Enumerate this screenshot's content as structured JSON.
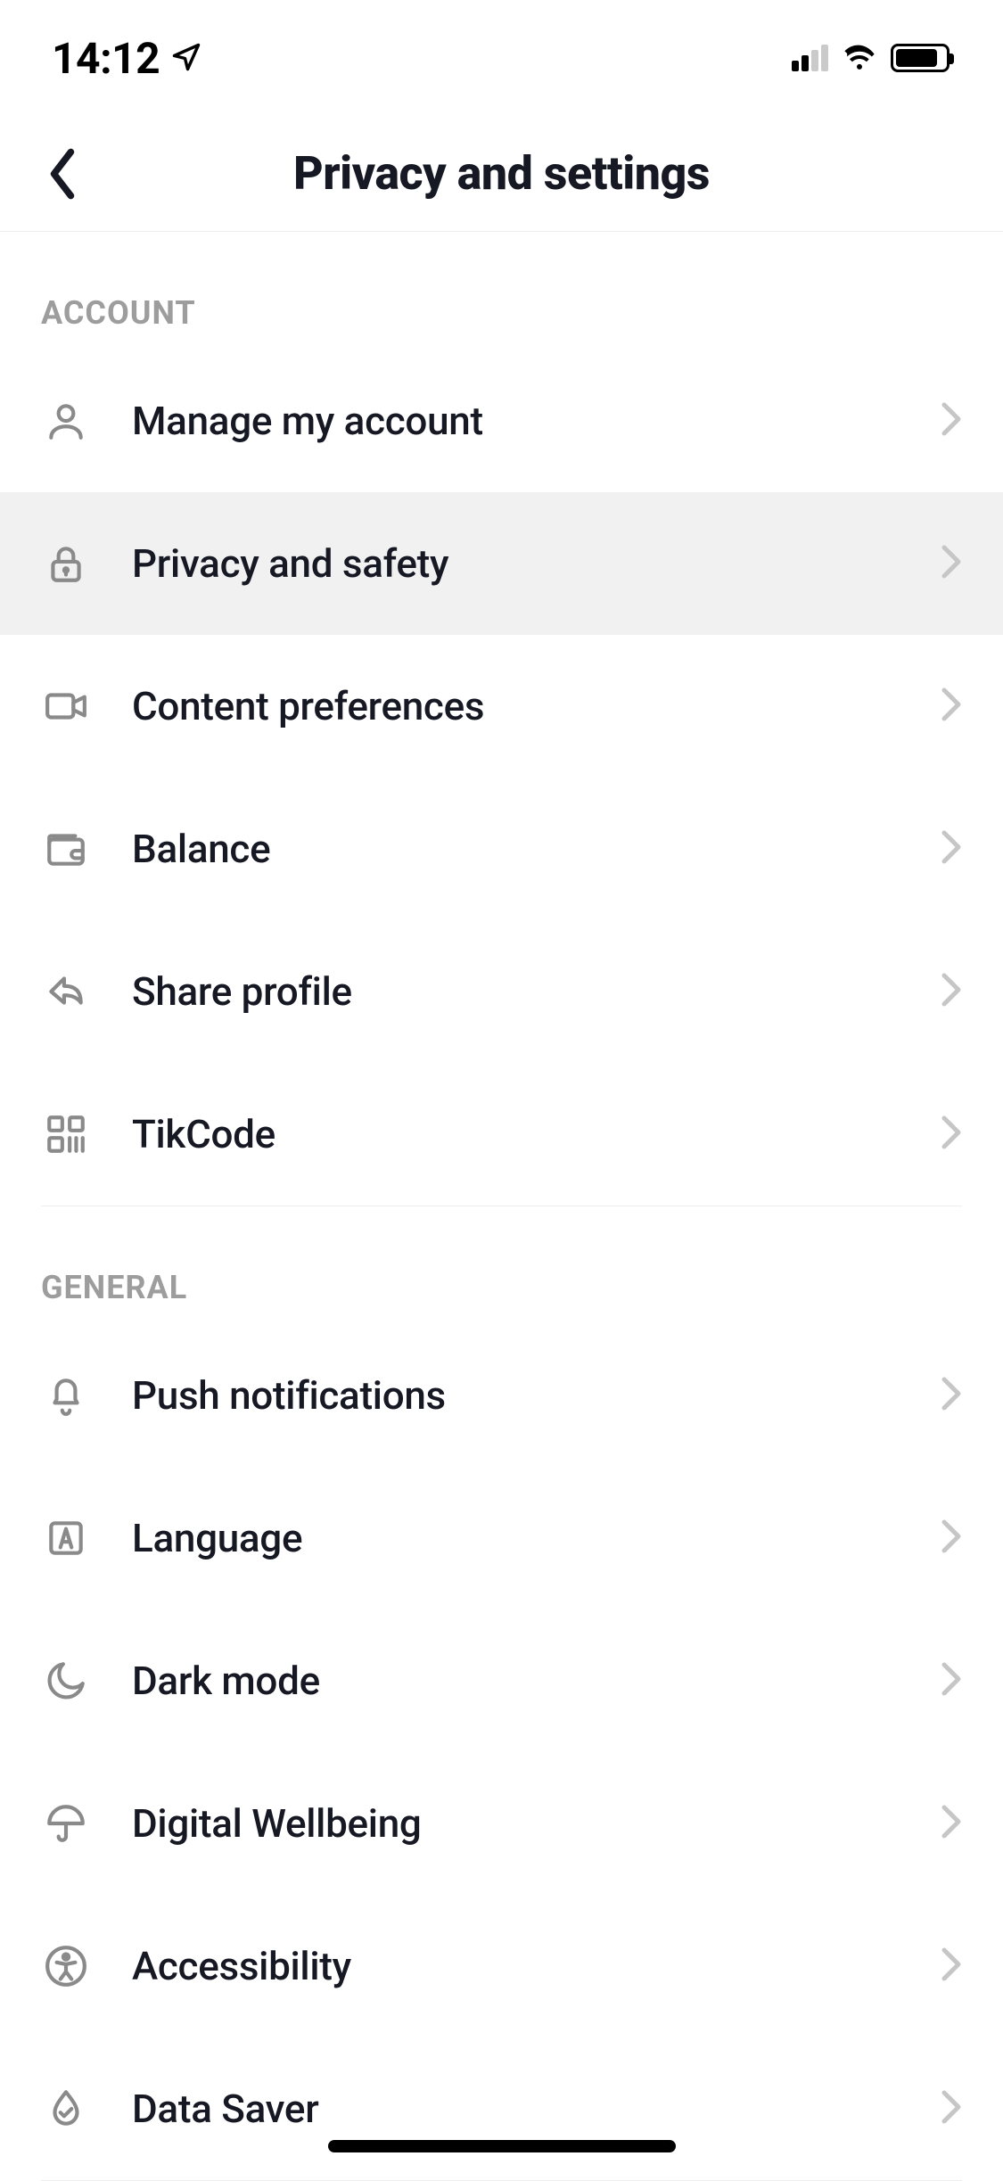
{
  "status": {
    "time": "14:12"
  },
  "header": {
    "title": "Privacy and settings"
  },
  "sections": {
    "account": {
      "title": "ACCOUNT",
      "items": {
        "manage": "Manage my account",
        "privacy": "Privacy and safety",
        "content": "Content preferences",
        "balance": "Balance",
        "share": "Share profile",
        "tikcode": "TikCode"
      }
    },
    "general": {
      "title": "GENERAL",
      "items": {
        "push": "Push notifications",
        "language": "Language",
        "dark": "Dark mode",
        "wellbeing": "Digital Wellbeing",
        "accessibility": "Accessibility",
        "datasaver": "Data Saver"
      }
    }
  }
}
